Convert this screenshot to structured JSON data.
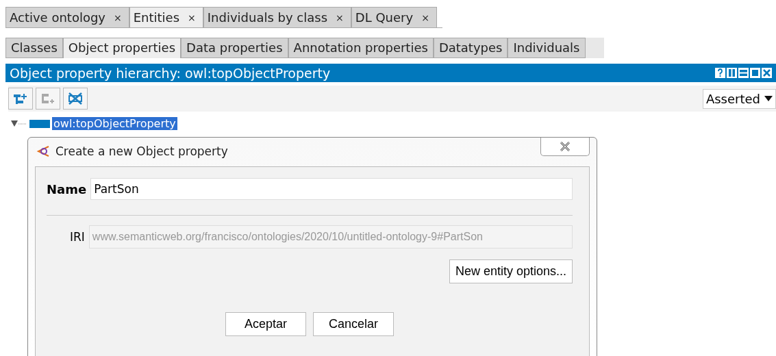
{
  "tabs": [
    {
      "label": "Active ontology",
      "close": "×",
      "selected": false
    },
    {
      "label": "Entities",
      "close": "×",
      "selected": true
    },
    {
      "label": "Individuals by class",
      "close": "×",
      "selected": false
    },
    {
      "label": "DL Query",
      "close": "×",
      "selected": false
    }
  ],
  "subtabs": [
    {
      "label": "Classes",
      "selected": false
    },
    {
      "label": "Object properties",
      "selected": true
    },
    {
      "label": "Data properties",
      "selected": false
    },
    {
      "label": "Annotation properties",
      "selected": false
    },
    {
      "label": "Datatypes",
      "selected": false
    },
    {
      "label": "Individuals",
      "selected": false
    }
  ],
  "view": {
    "title": "Object property hierarchy: owl:topObjectProperty",
    "mode": "Asserted"
  },
  "toolbar": [
    {
      "kind": "add-sub",
      "disabled": false
    },
    {
      "kind": "add-sibling",
      "disabled": true
    },
    {
      "kind": "delete",
      "disabled": false
    }
  ],
  "tree": [
    {
      "label": "owl:topObjectProperty",
      "selected": true,
      "expanded": true
    }
  ],
  "dialog": {
    "title": "Create a new Object property",
    "name_label": "Name",
    "name_value": "PartSon",
    "iri_label": "IRI",
    "iri_value": "www.semanticweb.org/francisco/ontologies/2020/10/untitled-ontology-9#PartSon",
    "options_button": "New entity options...",
    "buttons": [
      "Aceptar",
      "Cancelar"
    ]
  }
}
